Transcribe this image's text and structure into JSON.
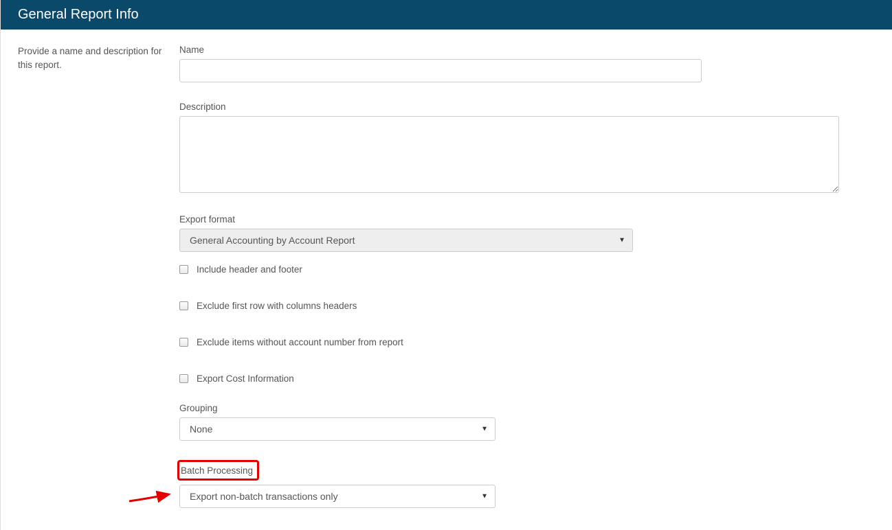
{
  "header": {
    "title": "General Report Info"
  },
  "side": {
    "helper_text": "Provide a name and description for this report."
  },
  "form": {
    "name_label": "Name",
    "name_value": "",
    "description_label": "Description",
    "description_value": "",
    "export_format_label": "Export format",
    "export_format_value": "General Accounting by Account Report",
    "checkboxes": {
      "include_header_footer": "Include header and footer",
      "exclude_first_row": "Exclude first row with columns headers",
      "exclude_no_account": "Exclude items without account number from report",
      "export_cost_info": "Export Cost Information"
    },
    "grouping_label": "Grouping",
    "grouping_value": "None",
    "batch_label": "Batch Processing",
    "batch_value": "Export non-batch transactions only"
  }
}
